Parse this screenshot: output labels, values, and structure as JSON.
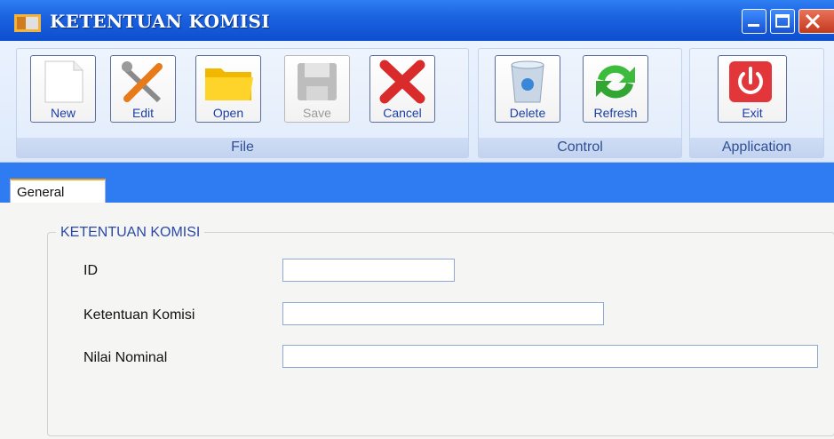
{
  "window": {
    "title": "KETENTUAN KOMISI",
    "colors": {
      "titlebar": "#1c63e0",
      "band": "#2f7cf2",
      "tab_accent": "#f3a21f",
      "label_blue": "#2c49a6"
    }
  },
  "toolbar": {
    "groups": [
      {
        "label": "File"
      },
      {
        "label": "Control"
      },
      {
        "label": "Application"
      }
    ],
    "buttons": {
      "new": {
        "label": "New",
        "icon": "new-document-icon"
      },
      "edit": {
        "label": "Edit",
        "icon": "edit-tools-icon"
      },
      "open": {
        "label": "Open",
        "icon": "folder-open-icon"
      },
      "save": {
        "label": "Save",
        "icon": "save-disk-icon",
        "disabled": true
      },
      "cancel": {
        "label": "Cancel",
        "icon": "cancel-x-icon"
      },
      "delete": {
        "label": "Delete",
        "icon": "recycle-bin-icon"
      },
      "refresh": {
        "label": "Refresh",
        "icon": "refresh-arrows-icon"
      },
      "exit": {
        "label": "Exit",
        "icon": "power-icon"
      }
    }
  },
  "tabs": [
    {
      "label": "General",
      "selected": true
    }
  ],
  "form": {
    "groupbox_title": "KETENTUAN KOMISI",
    "fields": {
      "id": {
        "label": "ID",
        "value": ""
      },
      "ketentuan": {
        "label": "Ketentuan Komisi",
        "value": ""
      },
      "nominal": {
        "label": "Nilai Nominal",
        "value": ""
      }
    }
  }
}
